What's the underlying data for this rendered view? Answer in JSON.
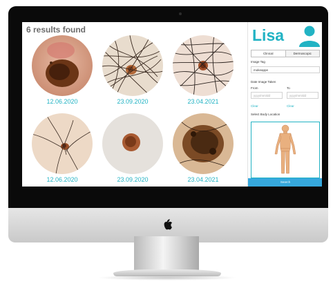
{
  "results": {
    "title": "6 results found",
    "items": [
      {
        "date": "12.06.2020"
      },
      {
        "date": "23.09.2020"
      },
      {
        "date": "23.04.2021"
      },
      {
        "date": "12.06.2020"
      },
      {
        "date": "23.09.2020"
      },
      {
        "date": "23.04.2021"
      }
    ]
  },
  "sidebar": {
    "username": "Lisa",
    "tabs": [
      "Clinical",
      "Dermoscopic"
    ],
    "image_tag_label": "Image Tag",
    "image_tag_value": "mokeappe",
    "date_label": "Date Image Taken",
    "from_label": "From",
    "to_label": "To",
    "from_placeholder": "yyyy/mm/dd",
    "to_placeholder": "yyyy/mm/dd",
    "clear_from": "Clear",
    "clear_to": "Clear",
    "body_location_label": "Select Body Location",
    "search_label": "Search"
  },
  "colors": {
    "accent": "#22b3c4",
    "button": "#36a8dd",
    "title": "#6b6b6b"
  }
}
